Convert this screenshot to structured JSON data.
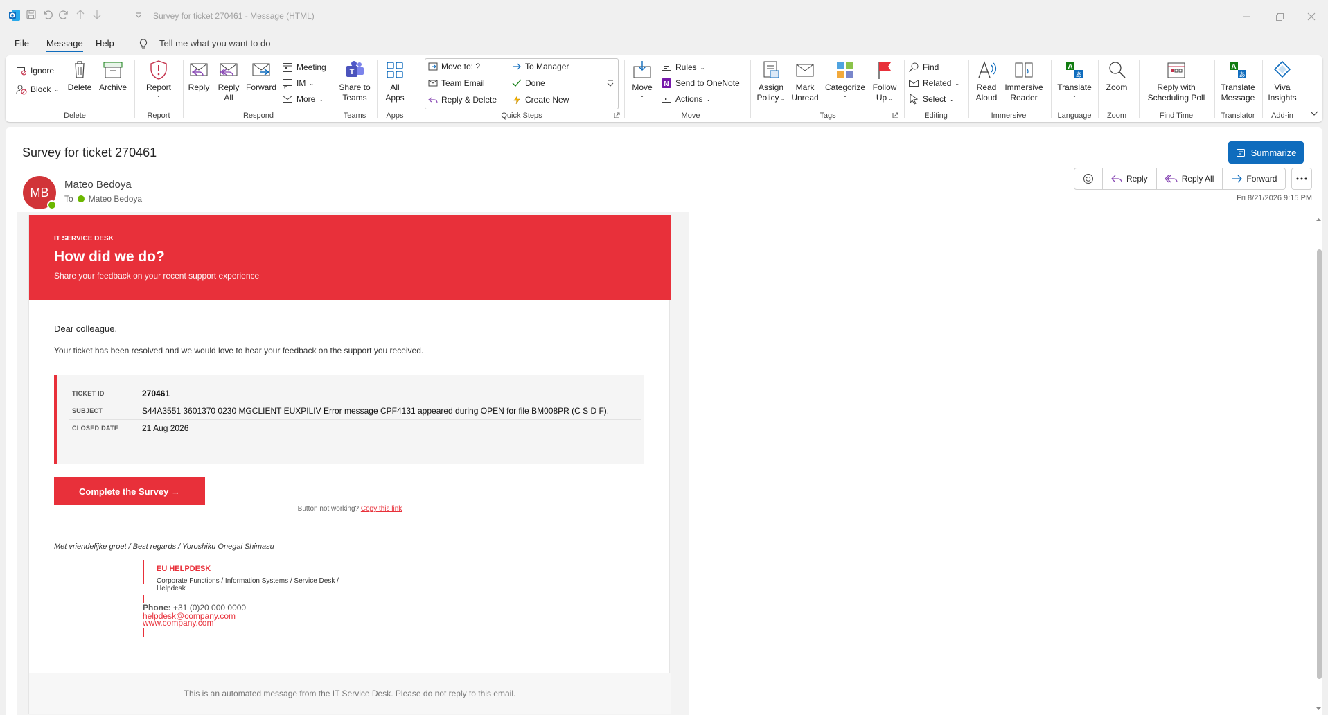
{
  "window": {
    "title": "Survey for ticket 270461  -  Message (HTML)"
  },
  "menu": {
    "file": "File",
    "message": "Message",
    "help": "Help",
    "tell_me": "Tell me what you want to do"
  },
  "ribbon": {
    "delete_group": {
      "ignore": "Ignore",
      "block": "Block",
      "delete": "Delete",
      "archive": "Archive",
      "label": "Delete"
    },
    "report_group": {
      "report": "Report",
      "label": "Report"
    },
    "respond_group": {
      "reply": "Reply",
      "reply_all_1": "Reply",
      "reply_all_2": "All",
      "forward": "Forward",
      "meeting": "Meeting",
      "im": "IM",
      "more": "More",
      "label": "Respond"
    },
    "teams_group": {
      "share_1": "Share to",
      "share_2": "Teams",
      "label": "Teams"
    },
    "apps_group": {
      "all_1": "All",
      "all_2": "Apps",
      "label": "Apps"
    },
    "quick_steps": {
      "move_to": "Move to: ?",
      "to_manager": "To Manager",
      "team_email": "Team Email",
      "done": "Done",
      "reply_delete": "Reply & Delete",
      "create_new": "Create New",
      "label": "Quick Steps"
    },
    "move_group": {
      "move": "Move",
      "rules": "Rules",
      "onenote": "Send to OneNote",
      "actions": "Actions",
      "label": "Move"
    },
    "tags_group": {
      "assign_1": "Assign",
      "assign_2": "Policy",
      "mark_1": "Mark",
      "mark_2": "Unread",
      "categorize": "Categorize",
      "follow_1": "Follow",
      "follow_2": "Up",
      "label": "Tags"
    },
    "editing_group": {
      "find": "Find",
      "related": "Related",
      "select": "Select",
      "label": "Editing"
    },
    "immersive_group": {
      "read_1": "Read",
      "read_2": "Aloud",
      "reader_1": "Immersive",
      "reader_2": "Reader",
      "label": "Immersive"
    },
    "language_group": {
      "translate": "Translate",
      "label": "Language"
    },
    "zoom_group": {
      "zoom": "Zoom",
      "label": "Zoom"
    },
    "findtime_group": {
      "poll_1": "Reply with",
      "poll_2": "Scheduling Poll",
      "label": "Find Time"
    },
    "translator_group": {
      "tm_1": "Translate",
      "tm_2": "Message",
      "label": "Translator"
    },
    "addin_group": {
      "viva_1": "Viva",
      "viva_2": "Insights",
      "label": "Add-in"
    }
  },
  "message": {
    "subject": "Survey for ticket 270461",
    "summarize": "Summarize",
    "avatar_initials": "MB",
    "sender": "Mateo Bedoya",
    "to_label": "To",
    "recipient": "Mateo Bedoya",
    "date": "Fri 8/21/2026 9:15 PM",
    "actions": {
      "reply": "Reply",
      "reply_all": "Reply All",
      "forward": "Forward"
    }
  },
  "email": {
    "kicker": "IT SERVICE DESK",
    "title": "How did we do?",
    "subtitle": "Share your feedback on your recent support experience",
    "greeting": "Dear colleague,",
    "intro": "Your ticket has been resolved and we would love to hear your feedback on the support you received.",
    "ticket": {
      "id_label": "TICKET ID",
      "id": "270461",
      "subject_label": "SUBJECT",
      "subject": "S44A3551 3601370 0230 MGCLIENT EUXPILIV Error message CPF4131 appeared during OPEN for file BM008PR (C S D F).",
      "closed_label": "CLOSED DATE",
      "closed": "21 Aug 2026"
    },
    "survey_button": "Complete the Survey →",
    "not_working": "Button not working?",
    "copy_link": "Copy this link",
    "regards": "Met vriendelijke groet / Best regards / Yoroshiku Onegai Shimasu",
    "sig_name": "EU HELPDESK",
    "sig_dept": "Corporate Functions / Information Systems / Service Desk / Helpdesk",
    "phone_label": "Phone:",
    "phone": "+31 (0)20 000 0000",
    "mail": "helpdesk@company.com",
    "web": "www.company.com",
    "footer": "This is an automated message from the IT Service Desk. Please do not reply to this email."
  },
  "colors": {
    "brand_red": "#e8303a",
    "accent_blue": "#0f6cbd",
    "avatar_red": "#d13438"
  }
}
